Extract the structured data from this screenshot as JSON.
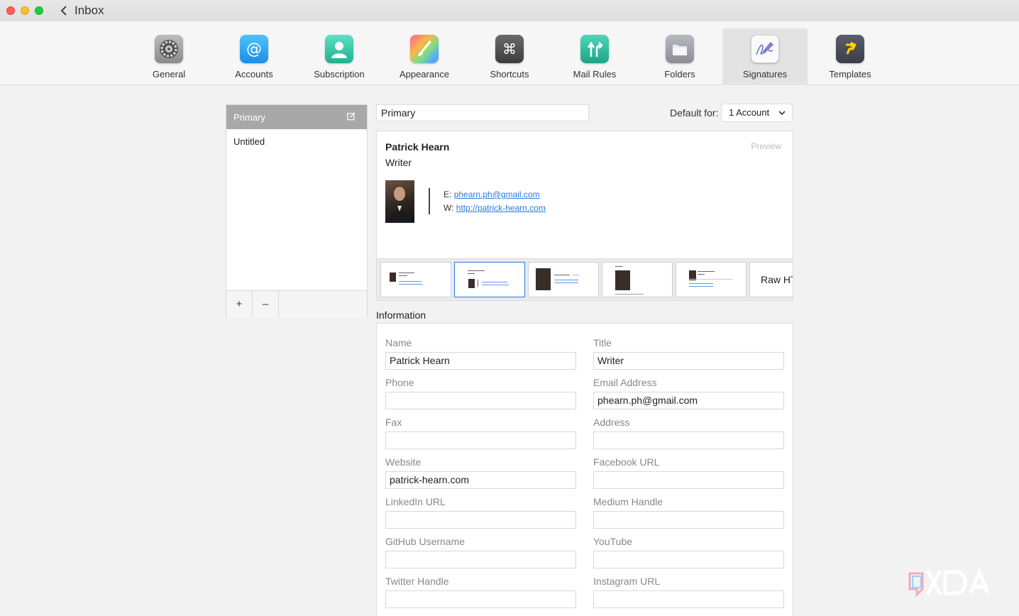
{
  "window": {
    "back_label": "Inbox"
  },
  "toolbar": {
    "items": [
      {
        "label": "General",
        "icon": "gear-icon"
      },
      {
        "label": "Accounts",
        "icon": "at-icon"
      },
      {
        "label": "Subscription",
        "icon": "person-icon"
      },
      {
        "label": "Appearance",
        "icon": "paintbrush-icon"
      },
      {
        "label": "Shortcuts",
        "icon": "command-icon"
      },
      {
        "label": "Mail Rules",
        "icon": "arrows-icon"
      },
      {
        "label": "Folders",
        "icon": "folder-icon"
      },
      {
        "label": "Signatures",
        "icon": "signature-icon",
        "active": true
      },
      {
        "label": "Templates",
        "icon": "template-icon"
      }
    ]
  },
  "signatures": {
    "items": [
      {
        "label": "Primary",
        "selected": true
      },
      {
        "label": "Untitled",
        "selected": false
      }
    ],
    "add_label": "+",
    "remove_label": "–"
  },
  "editor": {
    "signature_name": "Primary",
    "default_for_label": "Default for:",
    "default_for_value": "1 Account"
  },
  "preview": {
    "tag": "Preview",
    "name": "Patrick Hearn",
    "title": "Writer",
    "email_prefix": "E:",
    "email": "phearn.ph@gmail.com",
    "web_prefix": "W:",
    "web": "http://patrick-hearn.com"
  },
  "templates": {
    "raw_label": "Raw HT"
  },
  "information": {
    "title": "Information",
    "fields": [
      {
        "label": "Name",
        "value": "Patrick Hearn"
      },
      {
        "label": "Title",
        "value": "Writer"
      },
      {
        "label": "Phone",
        "value": ""
      },
      {
        "label": "Email Address",
        "value": "phearn.ph@gmail.com"
      },
      {
        "label": "Fax",
        "value": ""
      },
      {
        "label": "Address",
        "value": ""
      },
      {
        "label": "Website",
        "value": "patrick-hearn.com"
      },
      {
        "label": "Facebook URL",
        "value": ""
      },
      {
        "label": "LinkedIn URL",
        "value": ""
      },
      {
        "label": "Medium Handle",
        "value": ""
      },
      {
        "label": "GitHub Username",
        "value": ""
      },
      {
        "label": "YouTube",
        "value": ""
      },
      {
        "label": "Twitter Handle",
        "value": ""
      },
      {
        "label": "Instagram URL",
        "value": ""
      }
    ]
  },
  "colors": {
    "accent": "#2a7ae2",
    "selected_row": "#a8a8a8"
  }
}
